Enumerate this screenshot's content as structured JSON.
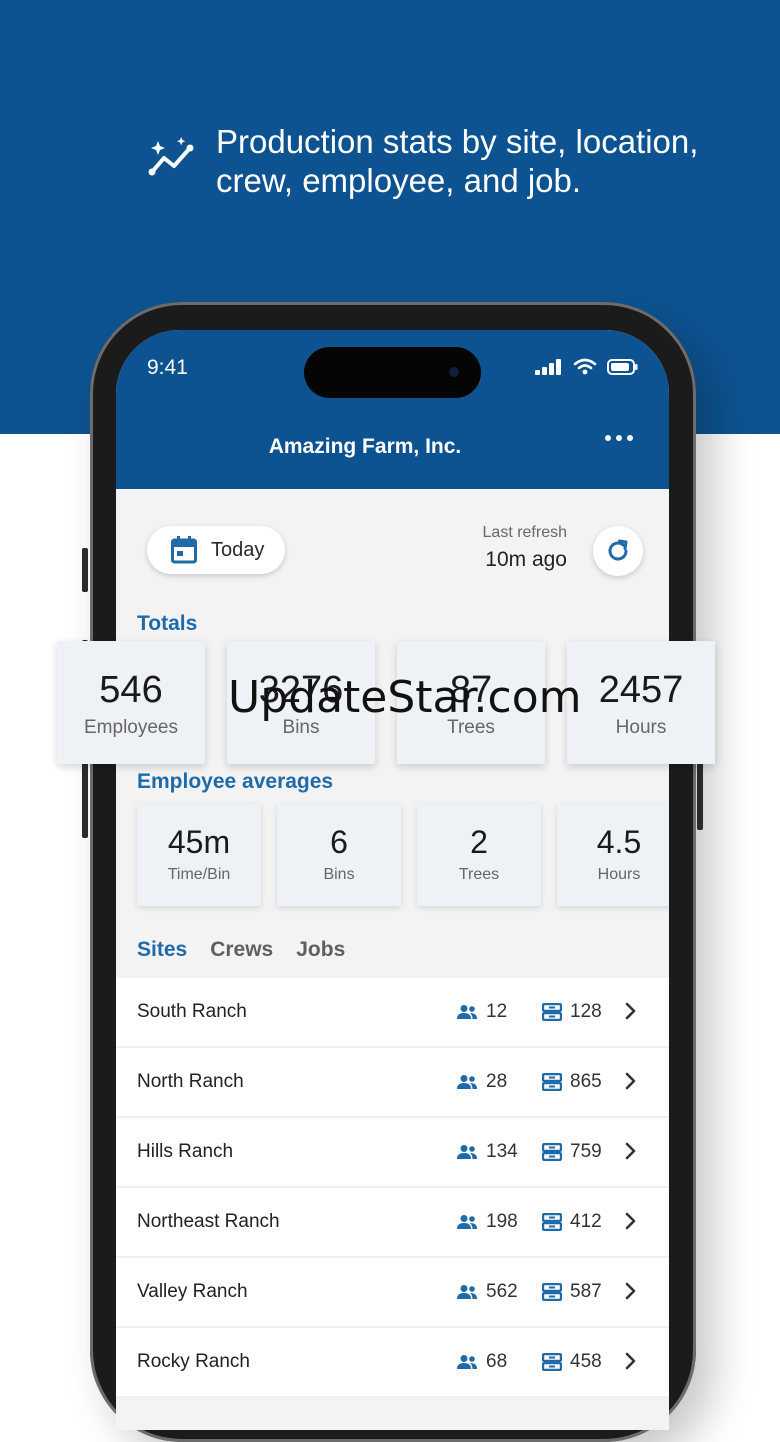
{
  "promo": {
    "headline": "Production stats by site, location, crew, employee, and job."
  },
  "status_bar": {
    "time": "9:41"
  },
  "header": {
    "title": "Amazing Farm, Inc."
  },
  "date_filter": {
    "label": "Today"
  },
  "refresh": {
    "label": "Last refresh",
    "value": "10m ago"
  },
  "totals": {
    "title": "Totals",
    "cards": [
      {
        "value": "546",
        "label": "Employees"
      },
      {
        "value": "3276",
        "label": "Bins"
      },
      {
        "value": "87",
        "label": "Trees"
      },
      {
        "value": "2457",
        "label": "Hours"
      }
    ]
  },
  "averages": {
    "title": "Employee averages",
    "cards": [
      {
        "value": "45m",
        "label": "Time/Bin"
      },
      {
        "value": "6",
        "label": "Bins"
      },
      {
        "value": "2",
        "label": "Trees"
      },
      {
        "value": "4.5",
        "label": "Hours"
      }
    ]
  },
  "tabs": [
    {
      "label": "Sites",
      "active": true
    },
    {
      "label": "Crews",
      "active": false
    },
    {
      "label": "Jobs",
      "active": false
    }
  ],
  "sites": [
    {
      "name": "South Ranch",
      "crew": "12",
      "bins": "128"
    },
    {
      "name": "North Ranch",
      "crew": "28",
      "bins": "865"
    },
    {
      "name": "Hills Ranch",
      "crew": "134",
      "bins": "759"
    },
    {
      "name": "Northeast Ranch",
      "crew": "198",
      "bins": "412"
    },
    {
      "name": "Valley Ranch",
      "crew": "562",
      "bins": "587"
    },
    {
      "name": "Rocky Ranch",
      "crew": "68",
      "bins": "458"
    }
  ],
  "watermark": "UpdateStar.com",
  "colors": {
    "brand": "#0d5391",
    "accent": "#1f6aa8",
    "background": "#f3f3f3"
  }
}
